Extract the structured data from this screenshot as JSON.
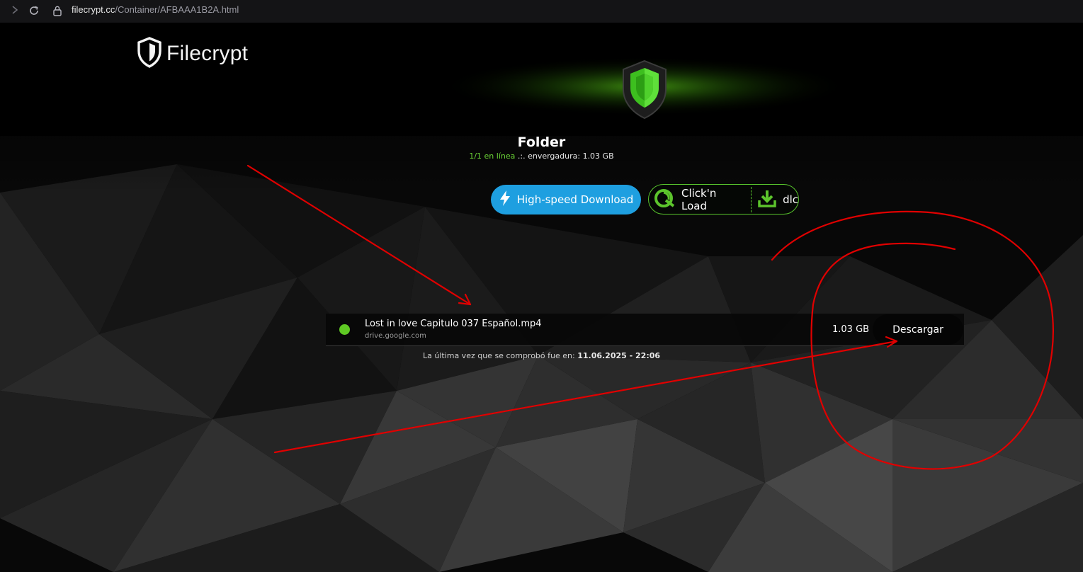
{
  "browser": {
    "url_host": "filecrypt.cc",
    "url_path": "/Container/AFBAAA1B2A.html"
  },
  "logo": {
    "text": "Filecrypt"
  },
  "folder": {
    "title": "Folder",
    "online": "1/1 en línea",
    "separator": " .:. ",
    "size_label": "envergadura: 1.03 GB"
  },
  "buttons": {
    "highspeed": "High-speed Download",
    "clicknload": "Click'n Load",
    "dlc": "dlc"
  },
  "file": {
    "name": "Lost in love Capitulo 037 Español.mp4",
    "host": "drive.google.com",
    "size": "1.03 GB",
    "download_label": "Descargar",
    "status_color": "#5fc924"
  },
  "last_check": {
    "label": "La última vez que se comprobó fue en: ",
    "datetime": "11.06.2025 - 22:06"
  },
  "colors": {
    "accent_blue": "#1e9fe0",
    "accent_green": "#58c42c",
    "annotation_red": "#e00000"
  },
  "icons": [
    "back-icon",
    "reload-icon",
    "lock-icon",
    "shield-logo-icon",
    "shield-emblem-icon",
    "lightning-icon",
    "clicknload-icon",
    "download-icon"
  ]
}
